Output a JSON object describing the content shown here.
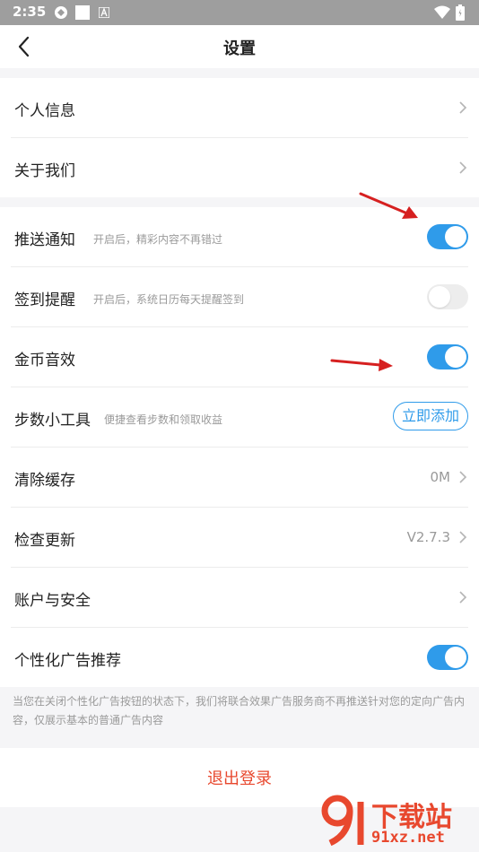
{
  "status_bar": {
    "time": "2:35"
  },
  "header": {
    "title": "设置"
  },
  "group1": [
    {
      "label": "个人信息"
    },
    {
      "label": "关于我们"
    }
  ],
  "group2": {
    "push": {
      "label": "推送通知",
      "hint": "开启后，精彩内容不再错过",
      "enabled": true
    },
    "checkin": {
      "label": "签到提醒",
      "hint": "开启后，系统日历每天提醒签到",
      "enabled": false
    },
    "coin": {
      "label": "金币音效",
      "enabled": true
    },
    "steps": {
      "label": "步数小工具",
      "hint": "便捷查看步数和领取收益",
      "button": "立即添加"
    },
    "cache": {
      "label": "清除缓存",
      "value": "0M"
    },
    "update": {
      "label": "检查更新",
      "value": "V2.7.3"
    },
    "account": {
      "label": "账户与安全"
    },
    "ads": {
      "label": "个性化广告推荐",
      "enabled": true
    }
  },
  "note": "当您在关闭个性化广告按钮的状态下，我们将联合效果广告服务商不再推送针对您的定向广告内容，仅展示基本的普通广告内容",
  "logout": "退出登录",
  "watermark": {
    "big": "下载站",
    "small": "91xz.net"
  },
  "colors": {
    "accent": "#2f9bea",
    "danger": "#e8482e",
    "arrow": "#d62020"
  }
}
